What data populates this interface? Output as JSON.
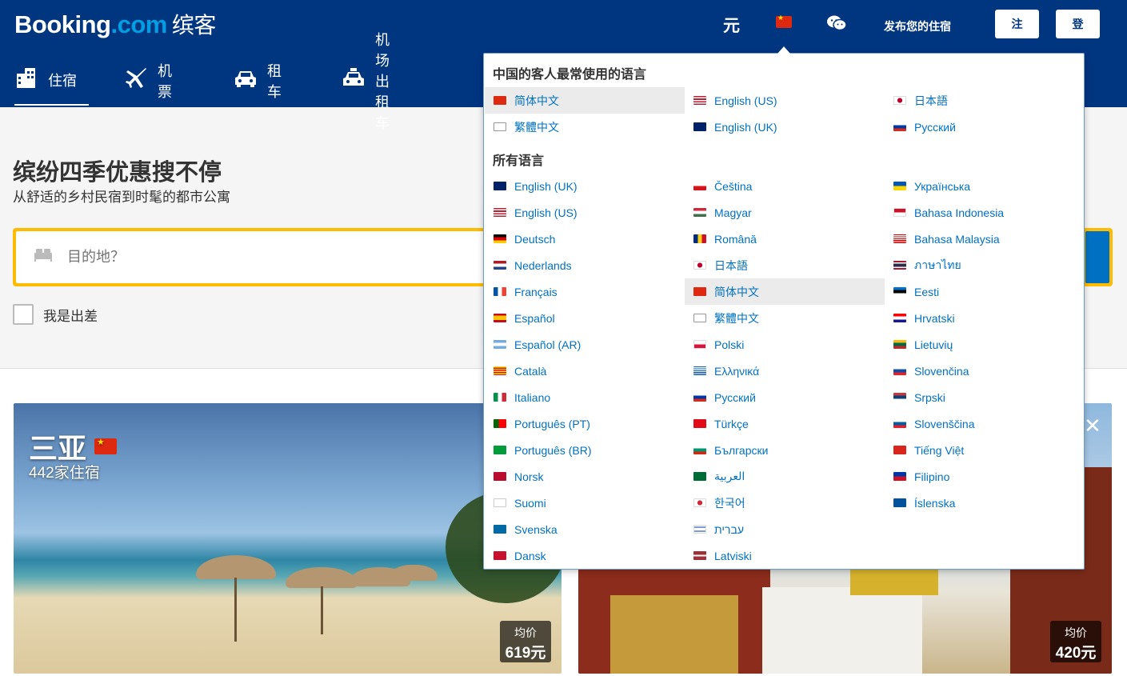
{
  "header": {
    "logo_main": "Booking",
    "logo_dot": ".com",
    "logo_cn": "缤客",
    "currency": "元",
    "list_property": "发布您的住宿",
    "register": "注册",
    "login": "登录"
  },
  "nav": [
    {
      "label": "住宿",
      "icon": "🏨"
    },
    {
      "label": "机票",
      "icon": "✈"
    },
    {
      "label": "租车",
      "icon": "🚘"
    },
    {
      "label": "机场出租车",
      "icon": "🚖"
    }
  ],
  "hero": {
    "title": "缤纷四季优惠搜不停",
    "subtitle": "从舒适的乡村民宿到时髦的都市公寓",
    "search_placeholder": "目的地？",
    "business_label": "我是出差"
  },
  "cards": [
    {
      "title": "三亚",
      "count": "442家住宿",
      "price_label": "均价",
      "price": "619元"
    },
    {
      "title": "",
      "count": "",
      "price_label": "均价",
      "price": "420元"
    }
  ],
  "languages": {
    "popular_heading": "中国的客人最常使用的语言",
    "all_heading": "所有语言",
    "popular": [
      {
        "label": "简体中文",
        "flag": "cn",
        "selected": true
      },
      {
        "label": "English (US)",
        "flag": "us"
      },
      {
        "label": "日本語",
        "flag": "jp"
      },
      {
        "label": "繁體中文",
        "flag": "tw"
      },
      {
        "label": "English (UK)",
        "flag": "uk"
      },
      {
        "label": "Русский",
        "flag": "ru"
      }
    ],
    "all_col1": [
      "English (UK)",
      "English (US)",
      "Deutsch",
      "Nederlands",
      "Français",
      "Español",
      "Español (AR)",
      "Català",
      "Italiano",
      "Português (PT)",
      "Português (BR)",
      "Norsk",
      "Suomi",
      "Svenska",
      "Dansk"
    ],
    "all_col2": [
      "Čeština",
      "Magyar",
      "Română",
      "日本語",
      "简体中文",
      "繁體中文",
      "Polski",
      "Ελληνικά",
      "Русский",
      "Türkçe",
      "Български",
      "العربية",
      "한국어",
      "עברית",
      "Latviski"
    ],
    "all_col3": [
      "Українська",
      "Bahasa Indonesia",
      "Bahasa Malaysia",
      "ภาษาไทย",
      "Eesti",
      "Hrvatski",
      "Lietuvių",
      "Slovenčina",
      "Srpski",
      "Slovenščina",
      "Tiếng Việt",
      "Filipino",
      "Íslenska"
    ],
    "flags_col1": [
      "uk",
      "us",
      "de",
      "nl",
      "fr",
      "es",
      "ar",
      "ca",
      "it",
      "pt",
      "br",
      "no",
      "fi",
      "se",
      "dk"
    ],
    "flags_col2": [
      "cz",
      "hu",
      "ro",
      "jp",
      "cn",
      "tw",
      "pl",
      "gr",
      "ru",
      "tr",
      "bg",
      "sa",
      "kr",
      "il",
      "lv"
    ],
    "flags_col3": [
      "ua",
      "id",
      "my",
      "th",
      "ee",
      "hr",
      "lt",
      "sk",
      "rs",
      "si",
      "vn",
      "ph",
      "is"
    ],
    "selected_all": "简体中文"
  },
  "colors": {
    "brand": "#003580",
    "accent": "#febb02",
    "link": "#0071c2"
  }
}
